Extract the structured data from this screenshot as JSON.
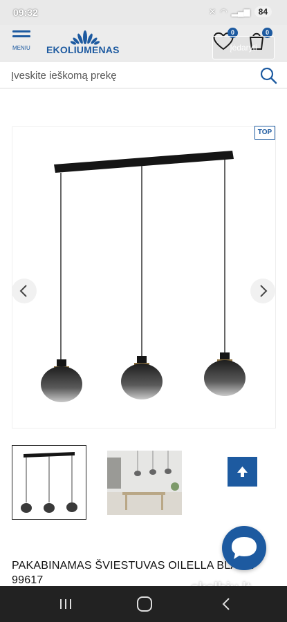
{
  "status_bar": {
    "time": "09:32",
    "battery": "84"
  },
  "header": {
    "menu_label": "MENIU",
    "logo_text": "EKOLIUMENAS",
    "wishlist_count": "0",
    "cart_count": "0",
    "login_label": "Įėdaryti"
  },
  "search": {
    "placeholder": "Įveskite ieškomą prekę"
  },
  "gallery": {
    "badge": "TOP",
    "thumbnail_count": 2
  },
  "product": {
    "title": "PAKABINAMAS ŠVIESTUVAS OILELLA BLACK 99617"
  },
  "watermark": {
    "text": "skelbiu.lt"
  },
  "colors": {
    "brand": "#1d5aa0",
    "status_bar": "#e9e9e9",
    "nav_bar": "#222222"
  },
  "icons": [
    "menu-icon",
    "logo-icon",
    "heart-icon",
    "cart-icon",
    "search-icon",
    "chevron-left-icon",
    "chevron-right-icon",
    "arrow-up-icon",
    "chat-icon",
    "recent-apps-icon",
    "home-icon",
    "back-icon"
  ]
}
